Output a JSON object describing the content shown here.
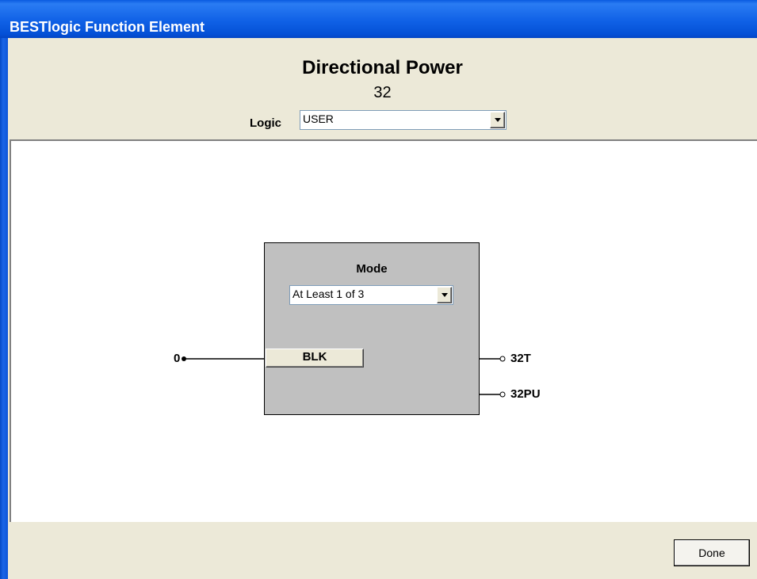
{
  "window": {
    "title": "BESTlogic Function Element"
  },
  "header": {
    "function_name": "Directional Power",
    "function_number": "32",
    "logic_label": "Logic",
    "logic_value": "USER"
  },
  "block": {
    "mode_label": "Mode",
    "mode_value": "At Least 1 of 3",
    "input_button_label": "BLK",
    "input_value": "0",
    "outputs": [
      "32T",
      "32PU"
    ]
  },
  "footer": {
    "done_label": "Done"
  },
  "icons": {
    "dropdown": "chevron-down-icon"
  },
  "colors": {
    "titlebar": "#0a5be0",
    "dialog_bg": "#ece9d8",
    "block_fill": "#c0c0c0",
    "canvas_bg": "#ffffff"
  }
}
